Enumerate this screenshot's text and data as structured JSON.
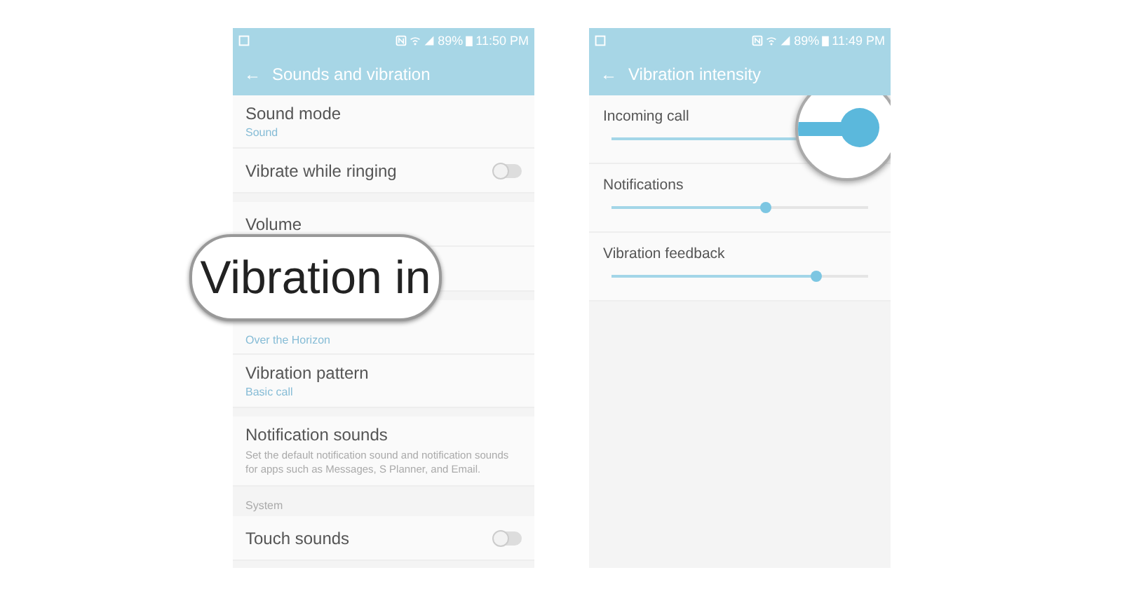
{
  "left_phone": {
    "status_bar": {
      "battery": "89%",
      "time": "11:50 PM"
    },
    "header": {
      "back": "←",
      "title": "Sounds and vibration"
    },
    "sections": [
      {
        "kind": "group",
        "items": [
          {
            "kind": "text",
            "title": "Sound mode",
            "subtitle": "Sound"
          },
          {
            "kind": "toggle",
            "title": "Vibrate while ringing",
            "on": false
          }
        ]
      },
      {
        "kind": "group",
        "items": [
          {
            "kind": "text",
            "title": "Volume"
          },
          {
            "kind": "blank"
          }
        ]
      },
      {
        "kind": "group",
        "items": [
          {
            "kind": "text",
            "subtitle": "Over the Horizon"
          },
          {
            "kind": "text",
            "title": "Vibration pattern",
            "subtitle": "Basic call"
          }
        ]
      },
      {
        "kind": "group",
        "items": [
          {
            "kind": "text",
            "title": "Notification sounds",
            "description": "Set the default notification sound and notification sounds for apps such as Messages, S Planner, and Email."
          }
        ]
      },
      {
        "kind": "header",
        "title": "System"
      },
      {
        "kind": "group",
        "items": [
          {
            "kind": "toggle",
            "title": "Touch sounds",
            "on": false
          }
        ]
      }
    ],
    "magnifier": {
      "text": "Vibration in"
    }
  },
  "right_phone": {
    "status_bar": {
      "battery": "89%",
      "time": "11:49 PM"
    },
    "header": {
      "back": "←",
      "title": "Vibration intensity"
    },
    "sliders": [
      {
        "label": "Incoming call",
        "level": 1.0,
        "magnified": true
      },
      {
        "label": "Notifications",
        "level": 0.6,
        "magnified": false
      },
      {
        "label": "Vibration feedback",
        "level": 0.8,
        "magnified": false
      }
    ]
  }
}
